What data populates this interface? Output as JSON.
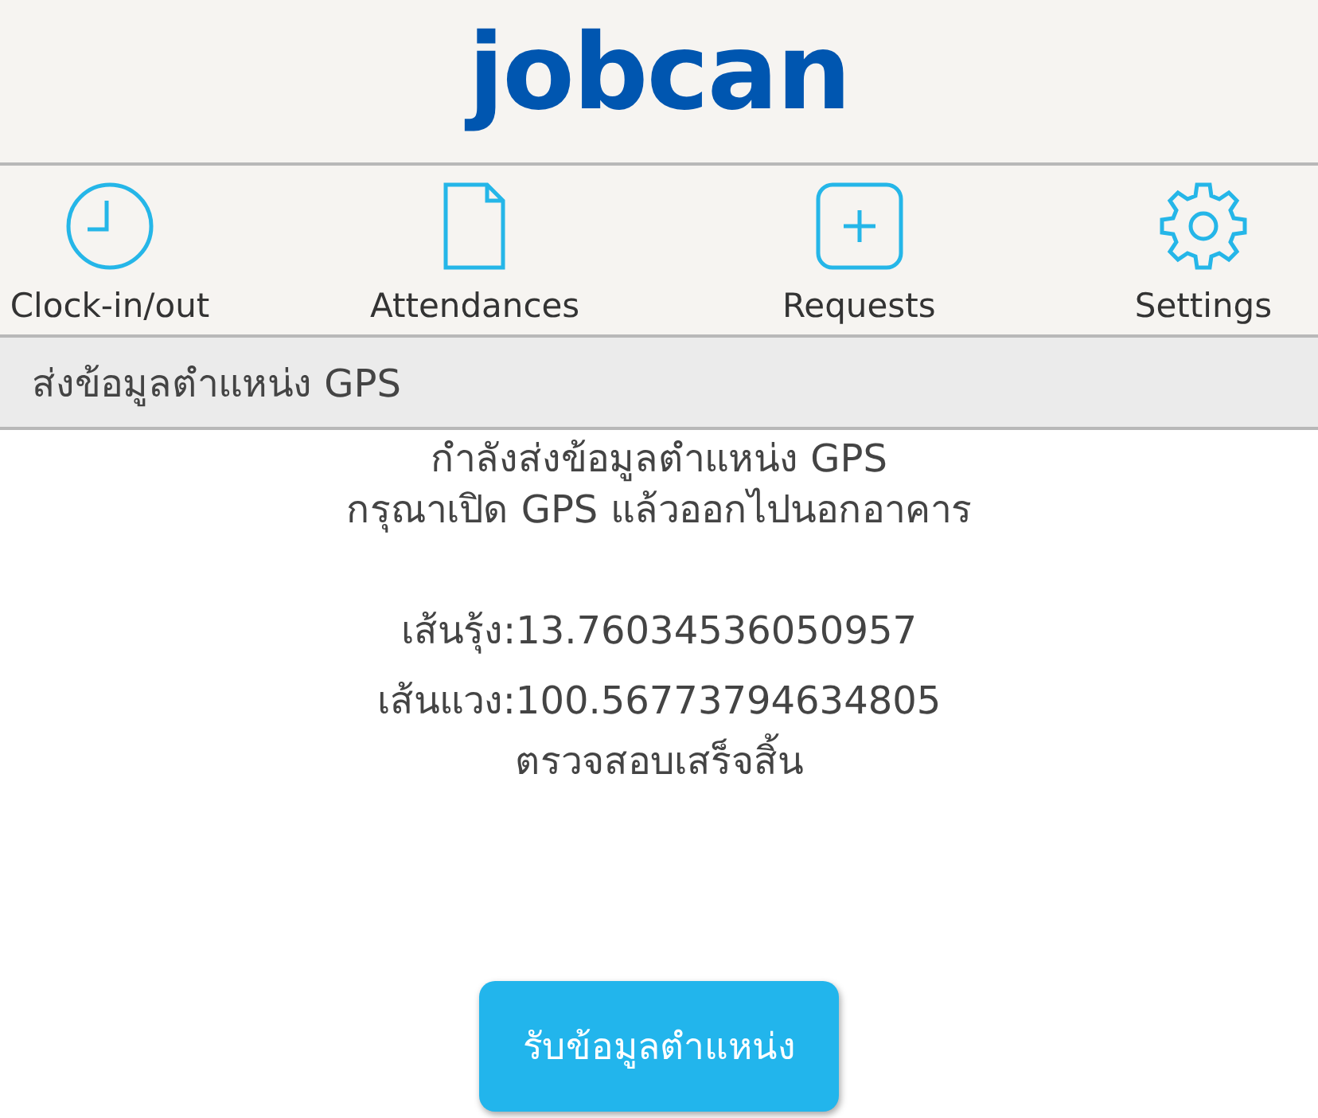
{
  "header": {
    "logo": "jobcan"
  },
  "nav": [
    {
      "label": "Clock-in/out"
    },
    {
      "label": "Attendances"
    },
    {
      "label": "Requests"
    },
    {
      "label": "Settings"
    }
  ],
  "section": {
    "title": "ส่งข้อมูลตำแหน่ง GPS"
  },
  "messages": [
    "กำลังส่งข้อมูลตำแหน่ง GPS",
    "กรุณาเปิด GPS แล้วออกไปนอกอาคาร"
  ],
  "coordinates": [
    {
      "text": "เส้นรุ้ง:13.76034536050957"
    },
    {
      "text": "เส้นแวง:100.56773794634805"
    }
  ],
  "status": "ตรวจสอบเสร็จสิ้น",
  "button": {
    "label": "รับข้อมูลตำแหน่ง"
  }
}
